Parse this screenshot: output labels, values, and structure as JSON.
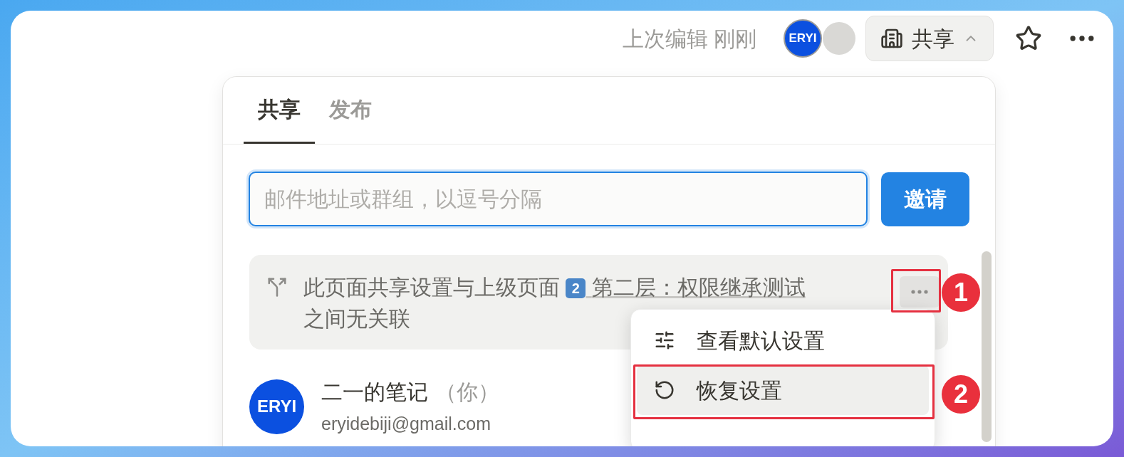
{
  "header": {
    "last_edited": "上次编辑 刚刚",
    "avatar_label": "ERYI",
    "share_button": "共享",
    "share_expanded": true
  },
  "tabs": [
    {
      "label": "共享",
      "selected": true
    },
    {
      "label": "发布",
      "selected": false
    }
  ],
  "invite": {
    "placeholder": "邮件地址或群组，以逗号分隔",
    "button": "邀请"
  },
  "notice": {
    "text_before": "此页面共享设置与上级页面",
    "badge": "2",
    "page": "第二层：权限继承测试",
    "text_after": "之间无关联"
  },
  "menu": [
    {
      "kind": "sliders",
      "label": "查看默认设置",
      "selected": false
    },
    {
      "kind": "reset",
      "label": "恢复设置",
      "selected": true
    }
  ],
  "member": {
    "avatar_label": "ERYI",
    "name": "二一的笔记",
    "you": "（你）",
    "email": "eryidebiji@gmail.com"
  },
  "annotations": [
    {
      "label": "1"
    },
    {
      "label": "2"
    }
  ]
}
